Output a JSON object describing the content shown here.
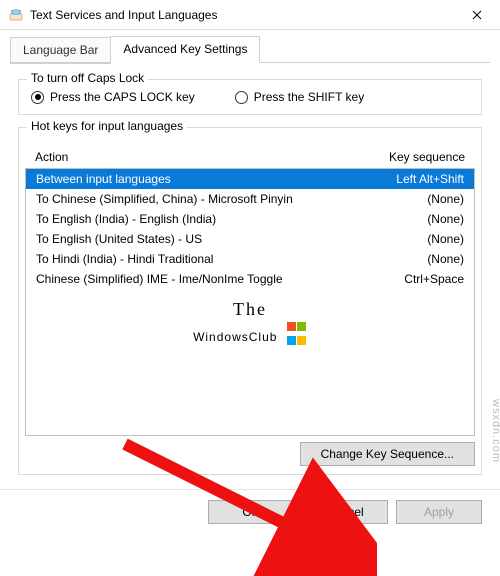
{
  "title": "Text Services and Input Languages",
  "tabs": {
    "language_bar": "Language Bar",
    "advanced": "Advanced Key Settings"
  },
  "capslock": {
    "legend": "To turn off Caps Lock",
    "opt_capslock": "Press the CAPS LOCK key",
    "opt_shift": "Press the SHIFT key"
  },
  "hotkeys": {
    "legend": "Hot keys for input languages",
    "col_action": "Action",
    "col_seq": "Key sequence",
    "rows": [
      {
        "action": "Between input languages",
        "seq": "Left Alt+Shift",
        "selected": true
      },
      {
        "action": "To Chinese (Simplified, China) - Microsoft Pinyin",
        "seq": "(None)"
      },
      {
        "action": "To English (India) - English (India)",
        "seq": "(None)"
      },
      {
        "action": "To English (United States) - US",
        "seq": "(None)"
      },
      {
        "action": "To Hindi (India) - Hindi Traditional",
        "seq": "(None)"
      },
      {
        "action": "Chinese (Simplified) IME - Ime/NonIme Toggle",
        "seq": "Ctrl+Space"
      }
    ],
    "change_btn": "Change Key Sequence..."
  },
  "watermark": {
    "line1": "The",
    "line2": "WindowsClub"
  },
  "aux": "wsxdn.com",
  "buttons": {
    "ok": "OK",
    "cancel": "Cancel",
    "apply": "Apply"
  }
}
